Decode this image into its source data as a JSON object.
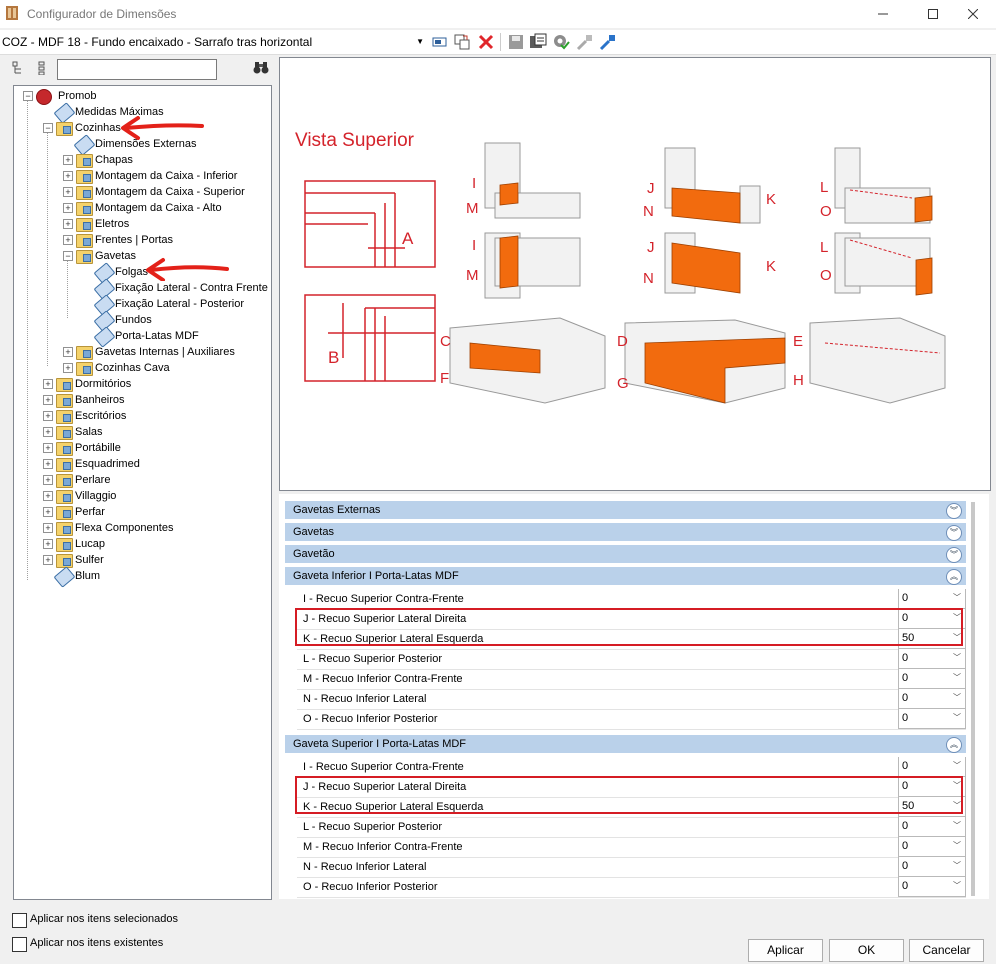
{
  "window": {
    "title": "Configurador de Dimensões"
  },
  "toolbar": {
    "profile": "COZ - MDF 18 - Fundo encaixado - Sarrafo tras horizontal"
  },
  "tree": {
    "search_value": "",
    "root": "Promob",
    "items": {
      "medidas": "Medidas Máximas",
      "cozinhas": "Cozinhas",
      "dimensoes": "Dimensões Externas",
      "chapas": "Chapas",
      "mont_inf": "Montagem da Caixa - Inferior",
      "mont_sup": "Montagem da Caixa - Superior",
      "mont_alto": "Montagem da Caixa - Alto",
      "eletros": "Eletros",
      "frentes": "Frentes | Portas",
      "gavetas": "Gavetas",
      "folgas": "Folgas",
      "fix_cf": "Fixação Lateral - Contra Frente",
      "fix_post": "Fixação Lateral - Posterior",
      "fundos": "Fundos",
      "portalatas": "Porta-Latas MDF",
      "gav_int": "Gavetas Internas | Auxiliares",
      "coz_cava": "Cozinhas Cava",
      "dormitorios": "Dormitórios",
      "banheiros": "Banheiros",
      "escritorios": "Escritórios",
      "salas": "Salas",
      "portabille": "Portábille",
      "esquadrimed": "Esquadrimed",
      "perlare": "Perlare",
      "villaggio": "Villaggio",
      "perfar": "Perfar",
      "flexa": "Flexa Componentes",
      "lucap": "Lucap",
      "sulfer": "Sulfer",
      "blum": "Blum"
    }
  },
  "diagram": {
    "title": "Vista Superior",
    "letters": [
      "A",
      "B",
      "C",
      "D",
      "E",
      "F",
      "G",
      "H",
      "I",
      "J",
      "K",
      "L",
      "M",
      "N",
      "O"
    ]
  },
  "sections": {
    "s1": "Gavetas Externas",
    "s2": "Gavetas",
    "s3": "Gavetão",
    "s4": "Gaveta Inferior I Porta-Latas MDF",
    "s5": "Gaveta Superior I Porta-Latas MDF"
  },
  "props": {
    "lbl_i": "I - Recuo Superior Contra-Frente",
    "lbl_j": "J - Recuo Superior Lateral Direita",
    "lbl_k": "K - Recuo Superior Lateral Esquerda",
    "lbl_l": "L - Recuo Superior Posterior",
    "lbl_m": "M - Recuo Inferior Contra-Frente",
    "lbl_n": "N - Recuo Inferior Lateral",
    "lbl_o": "O - Recuo Inferior Posterior",
    "inf": {
      "i": "0",
      "j": "0",
      "k": "50",
      "l": "0",
      "m": "0",
      "n": "0",
      "o": "0"
    },
    "sup": {
      "i": "0",
      "j": "0",
      "k": "50",
      "l": "0",
      "m": "0",
      "n": "0",
      "o": "0"
    }
  },
  "options": {
    "selected": "Aplicar nos itens selecionados",
    "existing": "Aplicar nos itens existentes"
  },
  "buttons": {
    "apply": "Aplicar",
    "ok": "OK",
    "cancel": "Cancelar"
  },
  "colors": {
    "accent_orange": "#f26b0e",
    "highlight_red": "#d51c24",
    "section_blue": "#bad1ea"
  }
}
